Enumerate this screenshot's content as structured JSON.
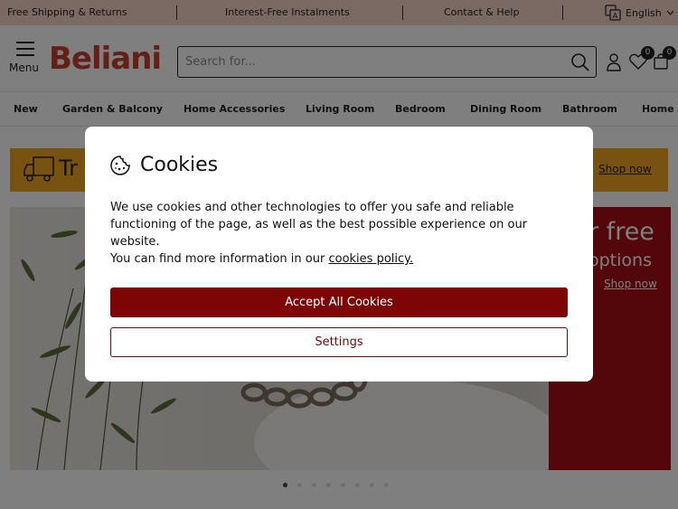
{
  "topbar": {
    "shipping": "Free Shipping & Returns",
    "instalments": "Interest-Free Instalments",
    "contact": "Contact & Help",
    "language": "English"
  },
  "header": {
    "menu_label": "Menu",
    "logo": "Beliani",
    "search_placeholder": "Search for...",
    "wishlist_count": "0",
    "cart_count": "0"
  },
  "nav": {
    "items": [
      "New",
      "Garden & Balcony",
      "Home Accessories",
      "Living Room",
      "Bedroom",
      "Dining Room",
      "Bathroom",
      "Home O"
    ]
  },
  "promo": {
    "text": "Tr",
    "shop_now": "Shop now"
  },
  "hero": {
    "headline": "r free",
    "subline": "options",
    "shop_now": "Shop now",
    "slide_count": 8,
    "active_slide": 1
  },
  "cookie_modal": {
    "title": "Cookies",
    "body_line1": "We use cookies and other technologies to offer you safe and reliable functioning of the page, as well as the best possible experience on our website.",
    "body_line2_prefix": "You can find more information in our ",
    "policy_link": "cookies policy.",
    "accept_label": "Accept All Cookies",
    "settings_label": "Settings"
  },
  "colors": {
    "topbar_bg": "#f6d5c8",
    "brand_red": "#c8412f",
    "accept_button": "#7d0505",
    "promo_bg": "#f0a422",
    "hero_red": "#a80f14"
  }
}
